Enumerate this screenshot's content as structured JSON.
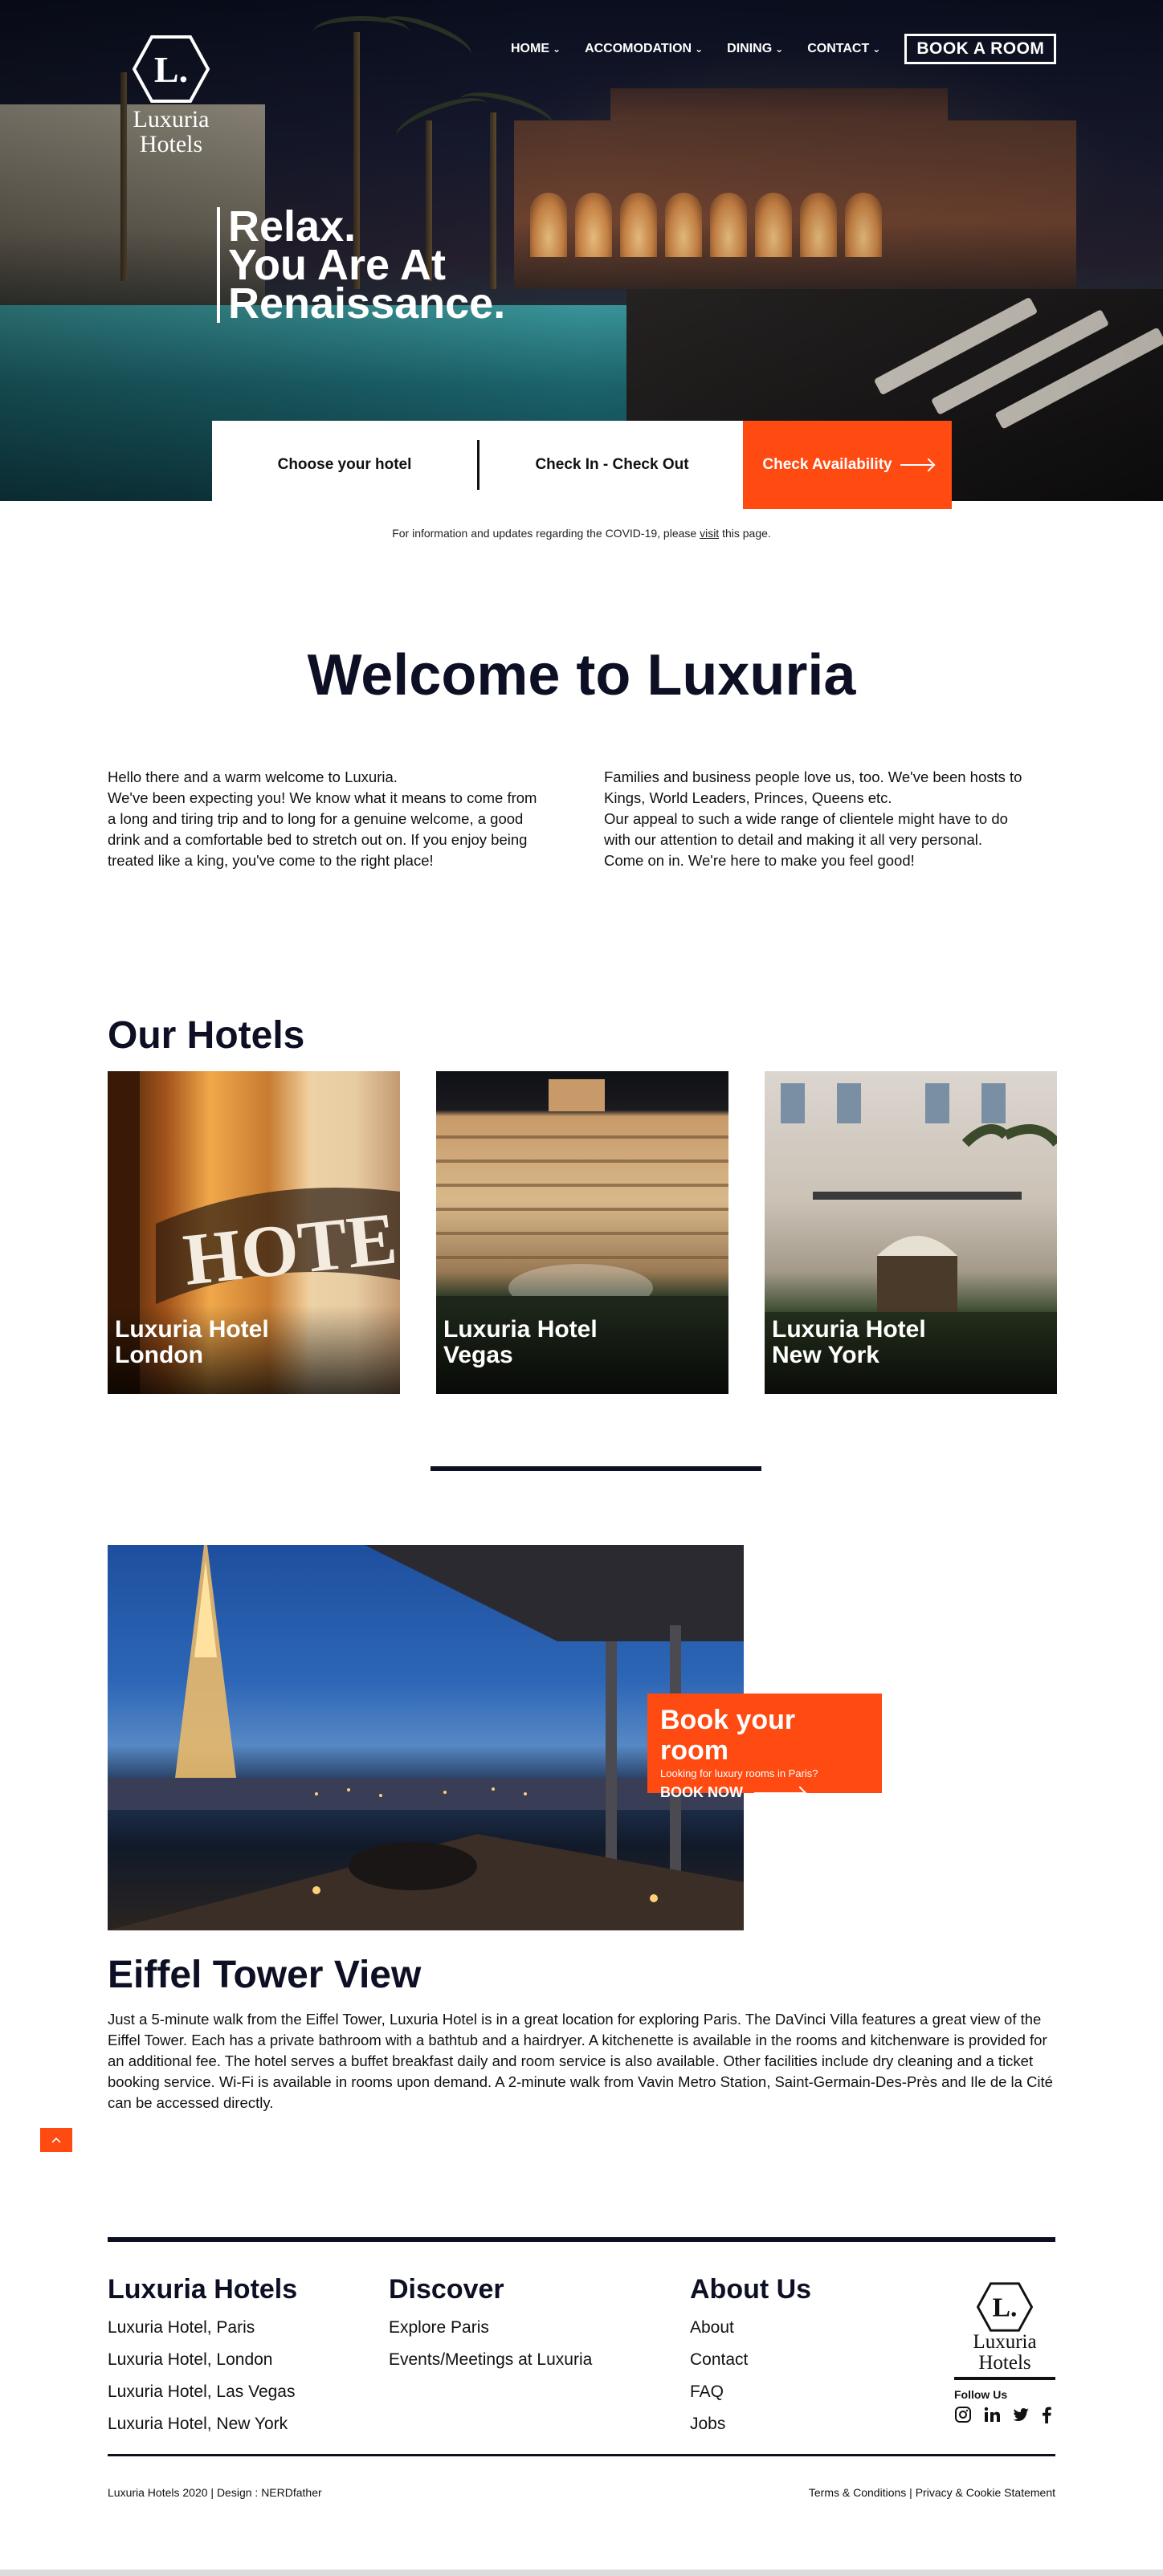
{
  "brand": {
    "logo_line1": "Luxuria",
    "logo_line2": "Hotels",
    "logo_letter": "L."
  },
  "nav": {
    "items": [
      {
        "label": "HOME"
      },
      {
        "label": "ACCOMODATION"
      },
      {
        "label": "DINING"
      },
      {
        "label": "CONTACT"
      }
    ],
    "book_label": "BOOK A ROOM"
  },
  "hero": {
    "line1": "Relax.",
    "line2": "You Are At",
    "line3": "Renaissance."
  },
  "booking": {
    "hotel_label": "Choose your hotel",
    "dates_label": "Check In - Check Out",
    "cta_label": "Check Availability"
  },
  "covid": {
    "text_before": "For information and updates regarding the COVID-19, please ",
    "link": "visit",
    "text_after": " this page."
  },
  "welcome": {
    "title": "Welcome to Luxuria",
    "left": "Hello there and a warm welcome to Luxuria.\nWe've been expecting you! We know what it means to come from a long and tiring trip and to long for a genuine welcome, a good drink and a comfortable bed to stretch out on. If you enjoy being treated like a king, you've come to the right place!",
    "right": "Families and business people love us, too. We've been hosts to Kings, World Leaders, Princes, Queens etc.\nOur appeal to such a wide range of clientele might have to do with our attention to detail and making it all very personal.\nCome on in. We're here to make you feel good!"
  },
  "hotels": {
    "title": "Our Hotels",
    "cards": [
      {
        "line1": "Luxuria Hotel",
        "line2": "London"
      },
      {
        "line1": "Luxuria Hotel",
        "line2": "Vegas"
      },
      {
        "line1": "Luxuria Hotel",
        "line2": "New York"
      }
    ]
  },
  "feature": {
    "promo_title": "Book your room",
    "promo_sub": "Looking for luxury rooms in Paris?",
    "promo_cta": "BOOK NOW",
    "title": "Eiffel Tower View",
    "body": "Just a 5-minute walk from the Eiffel Tower, Luxuria Hotel is in a great location for exploring Paris. The DaVinci Villa features a great view of the Eiffel Tower.  Each has a private bathroom with a bathtub and a hairdryer. A kitchenette is available in the rooms and kitchenware is provided for an additional fee. The hotel serves a buffet breakfast daily and room service is also available. Other facilities include dry cleaning and a ticket booking service. Wi-Fi is available in rooms upon demand. A 2-minute walk from Vavin Metro Station, Saint-Germain-Des-Près and Ile de la Cité can be accessed directly."
  },
  "footer": {
    "col1": {
      "title": "Luxuria Hotels",
      "links": [
        "Luxuria Hotel, Paris",
        "Luxuria Hotel, London",
        "Luxuria Hotel, Las Vegas",
        "Luxuria Hotel, New York"
      ]
    },
    "col2": {
      "title": "Discover",
      "links": [
        "Explore Paris",
        "Events/Meetings at Luxuria"
      ]
    },
    "col3": {
      "title": "About Us",
      "links": [
        "About",
        "Contact",
        "FAQ",
        "Jobs"
      ]
    },
    "follow_label": "Follow Us",
    "socials": [
      "instagram-icon",
      "linkedin-icon",
      "twitter-icon",
      "facebook-icon"
    ],
    "copyright": "Luxuria Hotels 2020 | Design : NERDfather",
    "terms": "Terms & Conditions",
    "separator": " | ",
    "privacy": "Privacy & Cookie Statement"
  },
  "colors": {
    "accent": "#ff4a12",
    "navy": "#0d0f24"
  }
}
